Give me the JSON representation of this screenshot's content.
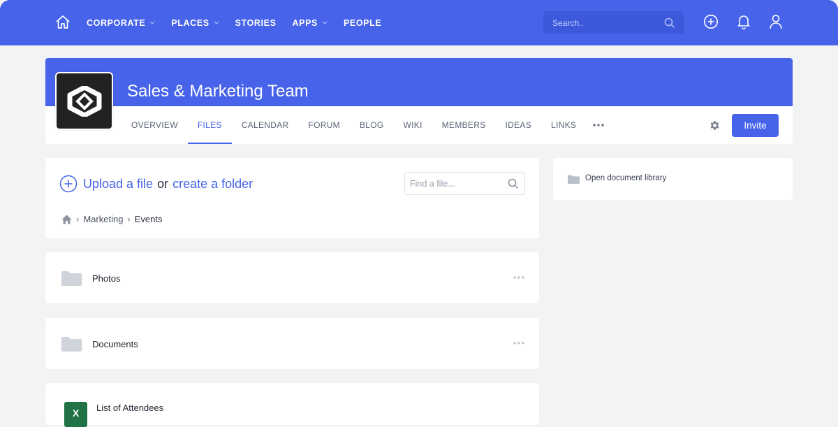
{
  "colors": {
    "primary": "#4663ea",
    "page_bg": "#f2f3f5",
    "excel_green": "#217346"
  },
  "topnav": {
    "items": [
      {
        "label": "CORPORATE",
        "has_dropdown": true
      },
      {
        "label": "PLACES",
        "has_dropdown": true
      },
      {
        "label": "STORIES",
        "has_dropdown": false
      },
      {
        "label": "APPS",
        "has_dropdown": true
      },
      {
        "label": "PEOPLE",
        "has_dropdown": false
      }
    ],
    "search_placeholder": "Search..",
    "icons": [
      "home-icon",
      "search-icon",
      "add-circle-icon",
      "bell-icon",
      "user-icon"
    ]
  },
  "team": {
    "title": "Sales & Marketing Team",
    "tabs": [
      {
        "label": "OVERVIEW",
        "active": false
      },
      {
        "label": "FILES",
        "active": true
      },
      {
        "label": "CALENDAR",
        "active": false
      },
      {
        "label": "FORUM",
        "active": false
      },
      {
        "label": "BLOG",
        "active": false
      },
      {
        "label": "WIKI",
        "active": false
      },
      {
        "label": "MEMBERS",
        "active": false
      },
      {
        "label": "IDEAS",
        "active": false
      },
      {
        "label": "LINKS",
        "active": false
      }
    ],
    "invite_label": "Invite"
  },
  "files": {
    "upload_label": "Upload a file",
    "or_label": "or",
    "create_folder_label": "create a folder",
    "find_placeholder": "Find a file...",
    "breadcrumb": {
      "items": [
        {
          "label": "Marketing",
          "current": false
        },
        {
          "label": "Events",
          "current": true
        }
      ]
    },
    "folders": [
      {
        "name": "Photos"
      },
      {
        "name": "Documents"
      }
    ],
    "file_items": [
      {
        "name": "List of Attendees",
        "type_letter": "X"
      }
    ]
  },
  "sidebar": {
    "library_label": "Open document library"
  }
}
